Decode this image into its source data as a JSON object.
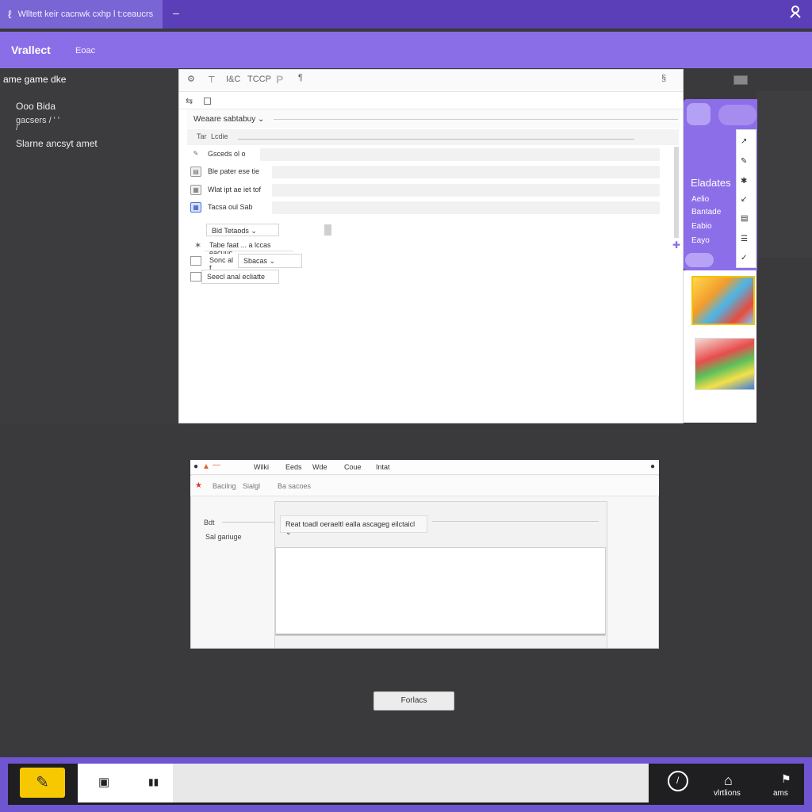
{
  "window": {
    "title": "Wlltett keir cacnwk cxhp l t:ceaucrs",
    "dash": "–"
  },
  "header": {
    "title": "Vrallect",
    "subtitle": "Eoac"
  },
  "left_panel": {
    "heading": "ame game dke",
    "line1": "Ooo Bida",
    "line2": "gacsers / ' '",
    "line2b": "/",
    "line3": "Slarne ancsyt amet"
  },
  "toolbar": {
    "item1": "I&C",
    "item2": "TCCP",
    "item3": "P",
    "item4": "¶"
  },
  "list": {
    "dropdown_label": "Weaare sabtabuy ⌄",
    "sub_a": "Tar",
    "sub_b": "Lcdie",
    "rows": [
      {
        "label": "Gsceds ol o"
      },
      {
        "label": "Ble pater ese tie"
      },
      {
        "label": "Wlat ipt ae iet tof"
      },
      {
        "label": "Tacsa oul Sab"
      }
    ]
  },
  "fields": {
    "f1": "Bld Tetaods ⌄",
    "f2": "Tabe faat ... a lccas eacuuc ⌄",
    "f3_left": "Sonc al f",
    "f3_right": "Sbacas ⌄",
    "f4": "Seecl anal ecliatte"
  },
  "side_panel": {
    "title": "Eladates",
    "items": [
      "Aelio",
      "Bantade",
      "Eabio",
      "Eayo"
    ]
  },
  "dialog": {
    "top_items": [
      "Wilki",
      "Eeds",
      "Wde",
      "Coue",
      "Intat"
    ],
    "sub_items": [
      "Bacilng",
      "Sialgl",
      "Ba sacoes"
    ],
    "label1": "Bdt",
    "label2": "Sal gariuge",
    "select": "Reat toadl oeraeltl ealla ascageg eilctaicl ⌄"
  },
  "center_button": {
    "label": "Forlacs"
  },
  "taskbar": {
    "label1": "vlrtlions",
    "label2": "ams"
  }
}
